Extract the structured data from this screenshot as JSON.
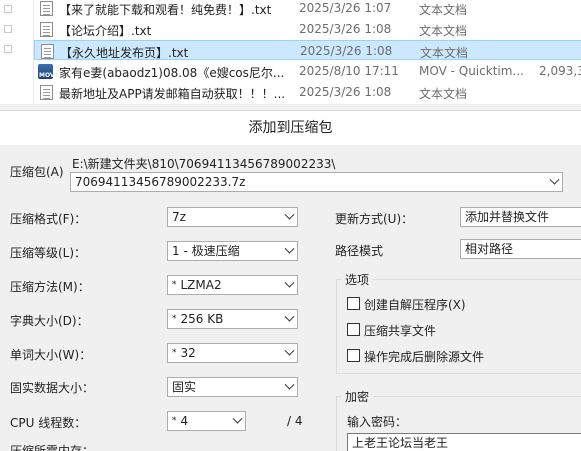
{
  "explorer": {
    "rows": [
      {
        "name": "【来了就能下载和观看！纯免费！】.txt",
        "date": "2025/3/26 1:07",
        "type": "文本文档",
        "size": "",
        "icon": "txt"
      },
      {
        "name": "【论坛介绍】.txt",
        "date": "2025/3/26 1:08",
        "type": "文本文档",
        "size": "",
        "icon": "txt"
      },
      {
        "name": "【永久地址发布页】.txt",
        "date": "2025/3/26 1:08",
        "type": "文本文档",
        "size": "",
        "icon": "txt"
      },
      {
        "name": "家有e妻(abaodz1)08.08《e嫂cos尼尔...",
        "date": "2025/8/10 17:11",
        "type": "MOV - Quicktim...",
        "size": "2,093,3",
        "icon": "mov"
      },
      {
        "name": "最新地址及APP请发邮箱自动获取！！！...",
        "date": "2025/3/26 1:08",
        "type": "文本文档",
        "size": "",
        "icon": "txt"
      }
    ],
    "selected_index": 2
  },
  "dialog": {
    "title": "添加到压缩包",
    "archive_label": "压缩包(A)",
    "archive_path": "E:\\新建文件夹\\810\\70694113456789002233\\",
    "archive_name": "70694113456789002233.7z",
    "format_label": "压缩格式(F)：",
    "format_value": "7z",
    "level_label": "压缩等级(L)：",
    "level_value": "1 - 极速压缩",
    "method_label": "压缩方法(M)：",
    "method_value": "LZMA2",
    "dict_label": "字典大小(D)：",
    "dict_value": "256 KB",
    "word_label": "单词大小(W)：",
    "word_value": "32",
    "solid_label": "固实数据大小：",
    "solid_value": "固实",
    "cpu_label": "CPU 线程数：",
    "cpu_value": "4",
    "cpu_total": "/ 4",
    "memory_label": "压缩所需内存：",
    "update_label": "更新方式(U)：",
    "update_value": "添加并替换文件",
    "path_label": "路径模式",
    "path_value": "相对路径",
    "options_title": "选项",
    "options": [
      {
        "label": "创建自解压程序(X)",
        "checked": false
      },
      {
        "label": "压缩共享文件",
        "checked": false
      },
      {
        "label": "操作完成后删除源文件",
        "checked": false
      }
    ],
    "encrypt_title": "加密",
    "password_label": "输入密码：",
    "password_value": "上老王论坛当老王"
  }
}
